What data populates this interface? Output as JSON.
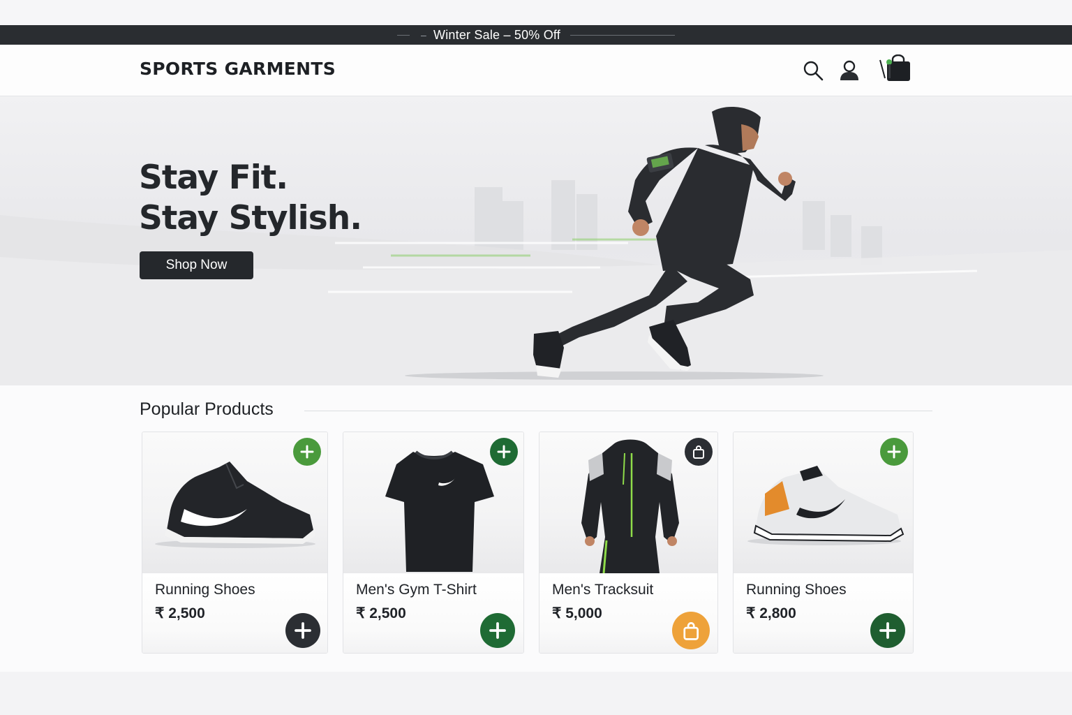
{
  "promo": {
    "text": "Winter Sale – 50% Off"
  },
  "header": {
    "logo": "SPORTS GARMENTS",
    "icons": [
      "search-icon",
      "user-icon",
      "shopping-bag-icon"
    ]
  },
  "hero": {
    "title_line1": "Stay Fit.",
    "title_line2": "Stay Stylish.",
    "cta_label": "Shop Now"
  },
  "products_section": {
    "title": "Popular Products",
    "items": [
      {
        "name": "Running Shoes",
        "price": "₹ 2,500",
        "top_icon": "plus-icon",
        "bottom_icon": "plus-icon",
        "top_color": "#4a9a3c",
        "bottom_color": "#2b2e33"
      },
      {
        "name": "Men's Gym T-Shirt",
        "price": "₹ 2,500",
        "top_icon": "plus-icon",
        "bottom_icon": "plus-icon",
        "top_color": "#1f6b34",
        "bottom_color": "#1f6b34"
      },
      {
        "name": "Men's Tracksuit",
        "price": "₹ 5,000",
        "top_icon": "bag-icon",
        "bottom_icon": "bag-icon",
        "top_color": "#2b2e33",
        "bottom_color": "#eea23a"
      },
      {
        "name": "Running Shoes",
        "price": "₹ 2,800",
        "top_icon": "plus-icon",
        "bottom_icon": "plus-icon",
        "top_color": "#4a9a3c",
        "bottom_color": "#1f5e30"
      }
    ]
  },
  "colors": {
    "promo_bg": "#2a2d31",
    "button_dark": "#25282c",
    "accent_green": "#4a9a3c",
    "accent_orange": "#eea23a"
  }
}
